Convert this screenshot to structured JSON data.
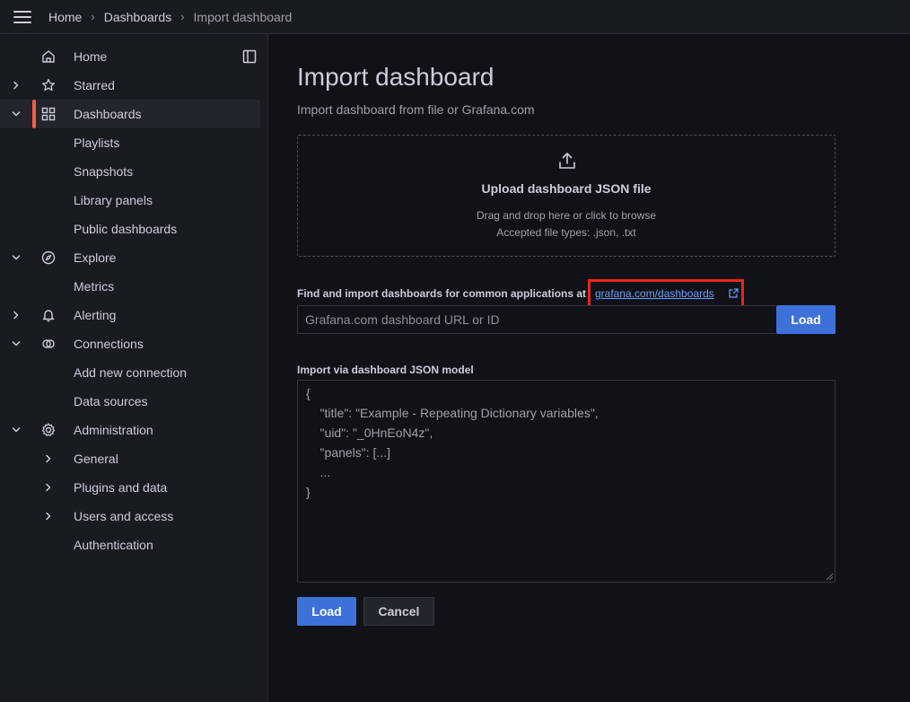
{
  "breadcrumb": [
    "Home",
    "Dashboards",
    "Import dashboard"
  ],
  "sidebar": {
    "items": [
      {
        "label": "Home",
        "icon": "home-icon",
        "chevron": "",
        "indent": false,
        "active": false
      },
      {
        "label": "Starred",
        "icon": "star-icon",
        "chevron": "right",
        "indent": false,
        "active": false
      },
      {
        "label": "Dashboards",
        "icon": "dashboards-grid-icon",
        "chevron": "down",
        "indent": false,
        "active": true
      },
      {
        "label": "Playlists",
        "icon": "",
        "chevron": "",
        "indent": true,
        "active": false
      },
      {
        "label": "Snapshots",
        "icon": "",
        "chevron": "",
        "indent": true,
        "active": false
      },
      {
        "label": "Library panels",
        "icon": "",
        "chevron": "",
        "indent": true,
        "active": false
      },
      {
        "label": "Public dashboards",
        "icon": "",
        "chevron": "",
        "indent": true,
        "active": false
      },
      {
        "label": "Explore",
        "icon": "compass-icon",
        "chevron": "down",
        "indent": false,
        "active": false
      },
      {
        "label": "Metrics",
        "icon": "",
        "chevron": "",
        "indent": true,
        "active": false
      },
      {
        "label": "Alerting",
        "icon": "bell-icon",
        "chevron": "right",
        "indent": false,
        "active": false
      },
      {
        "label": "Connections",
        "icon": "connections-icon",
        "chevron": "down",
        "indent": false,
        "active": false
      },
      {
        "label": "Add new connection",
        "icon": "",
        "chevron": "",
        "indent": true,
        "active": false
      },
      {
        "label": "Data sources",
        "icon": "",
        "chevron": "",
        "indent": true,
        "active": false
      },
      {
        "label": "Administration",
        "icon": "gear-icon",
        "chevron": "down",
        "indent": false,
        "active": false
      },
      {
        "label": "General",
        "icon": "",
        "chevron": "right-sub",
        "indent": true,
        "active": false
      },
      {
        "label": "Plugins and data",
        "icon": "",
        "chevron": "right-sub",
        "indent": true,
        "active": false
      },
      {
        "label": "Users and access",
        "icon": "",
        "chevron": "right-sub",
        "indent": true,
        "active": false
      },
      {
        "label": "Authentication",
        "icon": "",
        "chevron": "",
        "indent": true,
        "active": false
      }
    ]
  },
  "page": {
    "title": "Import dashboard",
    "subtitle": "Import dashboard from file or Grafana.com"
  },
  "upload": {
    "title": "Upload dashboard JSON file",
    "line1": "Drag and drop here or click to browse",
    "line2": "Accepted file types: .json, .txt"
  },
  "grafana_com": {
    "label": "Find and import dashboards for common applications at",
    "link_text": "grafana.com/dashboards",
    "input_placeholder": "Grafana.com dashboard URL or ID",
    "load_label": "Load"
  },
  "json_model": {
    "label": "Import via dashboard JSON model",
    "lines": [
      "{",
      "    \"title\": \"Example - Repeating Dictionary variables\",",
      "    \"uid\": \"_0HnEoN4z\",",
      "    \"panels\": [...]",
      "    ...",
      "}"
    ]
  },
  "actions": {
    "load_label": "Load",
    "cancel_label": "Cancel"
  },
  "colors": {
    "accent": "#3d71d9",
    "active_marker": "#f55f3e",
    "highlight": "#e8261c",
    "link": "#6e9fff"
  }
}
